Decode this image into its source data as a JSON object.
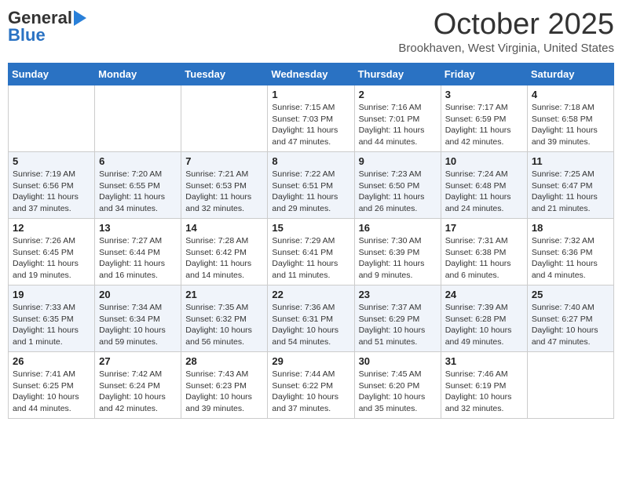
{
  "header": {
    "logo_line1": "General",
    "logo_line2": "Blue",
    "month": "October 2025",
    "location": "Brookhaven, West Virginia, United States"
  },
  "days_of_week": [
    "Sunday",
    "Monday",
    "Tuesday",
    "Wednesday",
    "Thursday",
    "Friday",
    "Saturday"
  ],
  "weeks": [
    [
      {
        "day": "",
        "info": ""
      },
      {
        "day": "",
        "info": ""
      },
      {
        "day": "",
        "info": ""
      },
      {
        "day": "1",
        "info": "Sunrise: 7:15 AM\nSunset: 7:03 PM\nDaylight: 11 hours and 47 minutes."
      },
      {
        "day": "2",
        "info": "Sunrise: 7:16 AM\nSunset: 7:01 PM\nDaylight: 11 hours and 44 minutes."
      },
      {
        "day": "3",
        "info": "Sunrise: 7:17 AM\nSunset: 6:59 PM\nDaylight: 11 hours and 42 minutes."
      },
      {
        "day": "4",
        "info": "Sunrise: 7:18 AM\nSunset: 6:58 PM\nDaylight: 11 hours and 39 minutes."
      }
    ],
    [
      {
        "day": "5",
        "info": "Sunrise: 7:19 AM\nSunset: 6:56 PM\nDaylight: 11 hours and 37 minutes."
      },
      {
        "day": "6",
        "info": "Sunrise: 7:20 AM\nSunset: 6:55 PM\nDaylight: 11 hours and 34 minutes."
      },
      {
        "day": "7",
        "info": "Sunrise: 7:21 AM\nSunset: 6:53 PM\nDaylight: 11 hours and 32 minutes."
      },
      {
        "day": "8",
        "info": "Sunrise: 7:22 AM\nSunset: 6:51 PM\nDaylight: 11 hours and 29 minutes."
      },
      {
        "day": "9",
        "info": "Sunrise: 7:23 AM\nSunset: 6:50 PM\nDaylight: 11 hours and 26 minutes."
      },
      {
        "day": "10",
        "info": "Sunrise: 7:24 AM\nSunset: 6:48 PM\nDaylight: 11 hours and 24 minutes."
      },
      {
        "day": "11",
        "info": "Sunrise: 7:25 AM\nSunset: 6:47 PM\nDaylight: 11 hours and 21 minutes."
      }
    ],
    [
      {
        "day": "12",
        "info": "Sunrise: 7:26 AM\nSunset: 6:45 PM\nDaylight: 11 hours and 19 minutes."
      },
      {
        "day": "13",
        "info": "Sunrise: 7:27 AM\nSunset: 6:44 PM\nDaylight: 11 hours and 16 minutes."
      },
      {
        "day": "14",
        "info": "Sunrise: 7:28 AM\nSunset: 6:42 PM\nDaylight: 11 hours and 14 minutes."
      },
      {
        "day": "15",
        "info": "Sunrise: 7:29 AM\nSunset: 6:41 PM\nDaylight: 11 hours and 11 minutes."
      },
      {
        "day": "16",
        "info": "Sunrise: 7:30 AM\nSunset: 6:39 PM\nDaylight: 11 hours and 9 minutes."
      },
      {
        "day": "17",
        "info": "Sunrise: 7:31 AM\nSunset: 6:38 PM\nDaylight: 11 hours and 6 minutes."
      },
      {
        "day": "18",
        "info": "Sunrise: 7:32 AM\nSunset: 6:36 PM\nDaylight: 11 hours and 4 minutes."
      }
    ],
    [
      {
        "day": "19",
        "info": "Sunrise: 7:33 AM\nSunset: 6:35 PM\nDaylight: 11 hours and 1 minute."
      },
      {
        "day": "20",
        "info": "Sunrise: 7:34 AM\nSunset: 6:34 PM\nDaylight: 10 hours and 59 minutes."
      },
      {
        "day": "21",
        "info": "Sunrise: 7:35 AM\nSunset: 6:32 PM\nDaylight: 10 hours and 56 minutes."
      },
      {
        "day": "22",
        "info": "Sunrise: 7:36 AM\nSunset: 6:31 PM\nDaylight: 10 hours and 54 minutes."
      },
      {
        "day": "23",
        "info": "Sunrise: 7:37 AM\nSunset: 6:29 PM\nDaylight: 10 hours and 51 minutes."
      },
      {
        "day": "24",
        "info": "Sunrise: 7:39 AM\nSunset: 6:28 PM\nDaylight: 10 hours and 49 minutes."
      },
      {
        "day": "25",
        "info": "Sunrise: 7:40 AM\nSunset: 6:27 PM\nDaylight: 10 hours and 47 minutes."
      }
    ],
    [
      {
        "day": "26",
        "info": "Sunrise: 7:41 AM\nSunset: 6:25 PM\nDaylight: 10 hours and 44 minutes."
      },
      {
        "day": "27",
        "info": "Sunrise: 7:42 AM\nSunset: 6:24 PM\nDaylight: 10 hours and 42 minutes."
      },
      {
        "day": "28",
        "info": "Sunrise: 7:43 AM\nSunset: 6:23 PM\nDaylight: 10 hours and 39 minutes."
      },
      {
        "day": "29",
        "info": "Sunrise: 7:44 AM\nSunset: 6:22 PM\nDaylight: 10 hours and 37 minutes."
      },
      {
        "day": "30",
        "info": "Sunrise: 7:45 AM\nSunset: 6:20 PM\nDaylight: 10 hours and 35 minutes."
      },
      {
        "day": "31",
        "info": "Sunrise: 7:46 AM\nSunset: 6:19 PM\nDaylight: 10 hours and 32 minutes."
      },
      {
        "day": "",
        "info": ""
      }
    ]
  ]
}
